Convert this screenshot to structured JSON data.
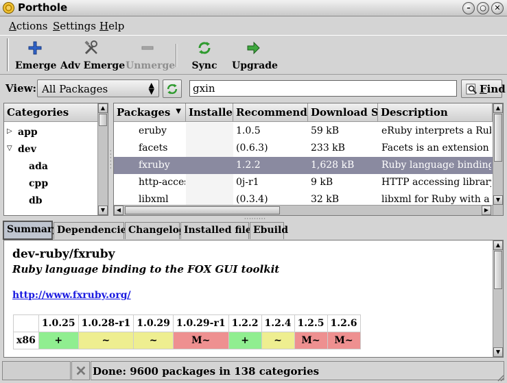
{
  "window": {
    "title": "Porthole"
  },
  "menu": [
    "Actions",
    "Settings",
    "Help"
  ],
  "toolbar": {
    "emerge": "Emerge",
    "adv_emerge": "Adv Emerge",
    "unmerge": "Unmerge",
    "sync": "Sync",
    "upgrade": "Upgrade"
  },
  "view": {
    "label": "View:",
    "selected": "All Packages",
    "search_value": "gxin",
    "find_label": "Find"
  },
  "categories": {
    "header": "Categories",
    "items": [
      "app",
      "dev",
      "ada",
      "cpp",
      "db"
    ]
  },
  "packages": {
    "headers": [
      "Packages",
      "Installed",
      "Recommended",
      "Download Size",
      "Description"
    ],
    "rows": [
      [
        "eruby",
        "",
        "1.0.5",
        "59 kB",
        "eRuby interprets a Ruby code embedded text file"
      ],
      [
        "facets",
        "",
        "(0.6.3)",
        "233 kB",
        "Facets is an extension library"
      ],
      [
        "fxruby",
        "",
        "1.2.2",
        "1,628 kB",
        "Ruby language binding to the FOX GUI toolkit"
      ],
      [
        "http-access",
        "",
        "0j-r1",
        "9 kB",
        "HTTP accessing library"
      ],
      [
        "libxml",
        "",
        "(0.3.4)",
        "32 kB",
        "libxml for Ruby with a user-friendly API"
      ]
    ],
    "selected_index": 2
  },
  "tabs": [
    "Summary",
    "Dependencies",
    "Changelog",
    "Installed files",
    "Ebuild"
  ],
  "summary": {
    "name": "dev-ruby/fxruby",
    "description": "Ruby language binding to the FOX GUI toolkit",
    "homepage": "http://www.fxruby.org/",
    "arch": "x86",
    "versions": [
      "1.0.25",
      "1.0.28-r1",
      "1.0.29",
      "1.0.29-r1",
      "1.2.2",
      "1.2.4",
      "1.2.5",
      "1.2.6"
    ],
    "keywords": [
      "+",
      "~",
      "~",
      "M~",
      "+",
      "~",
      "M~",
      "M~"
    ],
    "colors": {
      "+": "#90ee90",
      "~": "#eeee90",
      "M~": "#ee9090"
    }
  },
  "status": {
    "text": "Done: 9600 packages in 138 categories"
  }
}
